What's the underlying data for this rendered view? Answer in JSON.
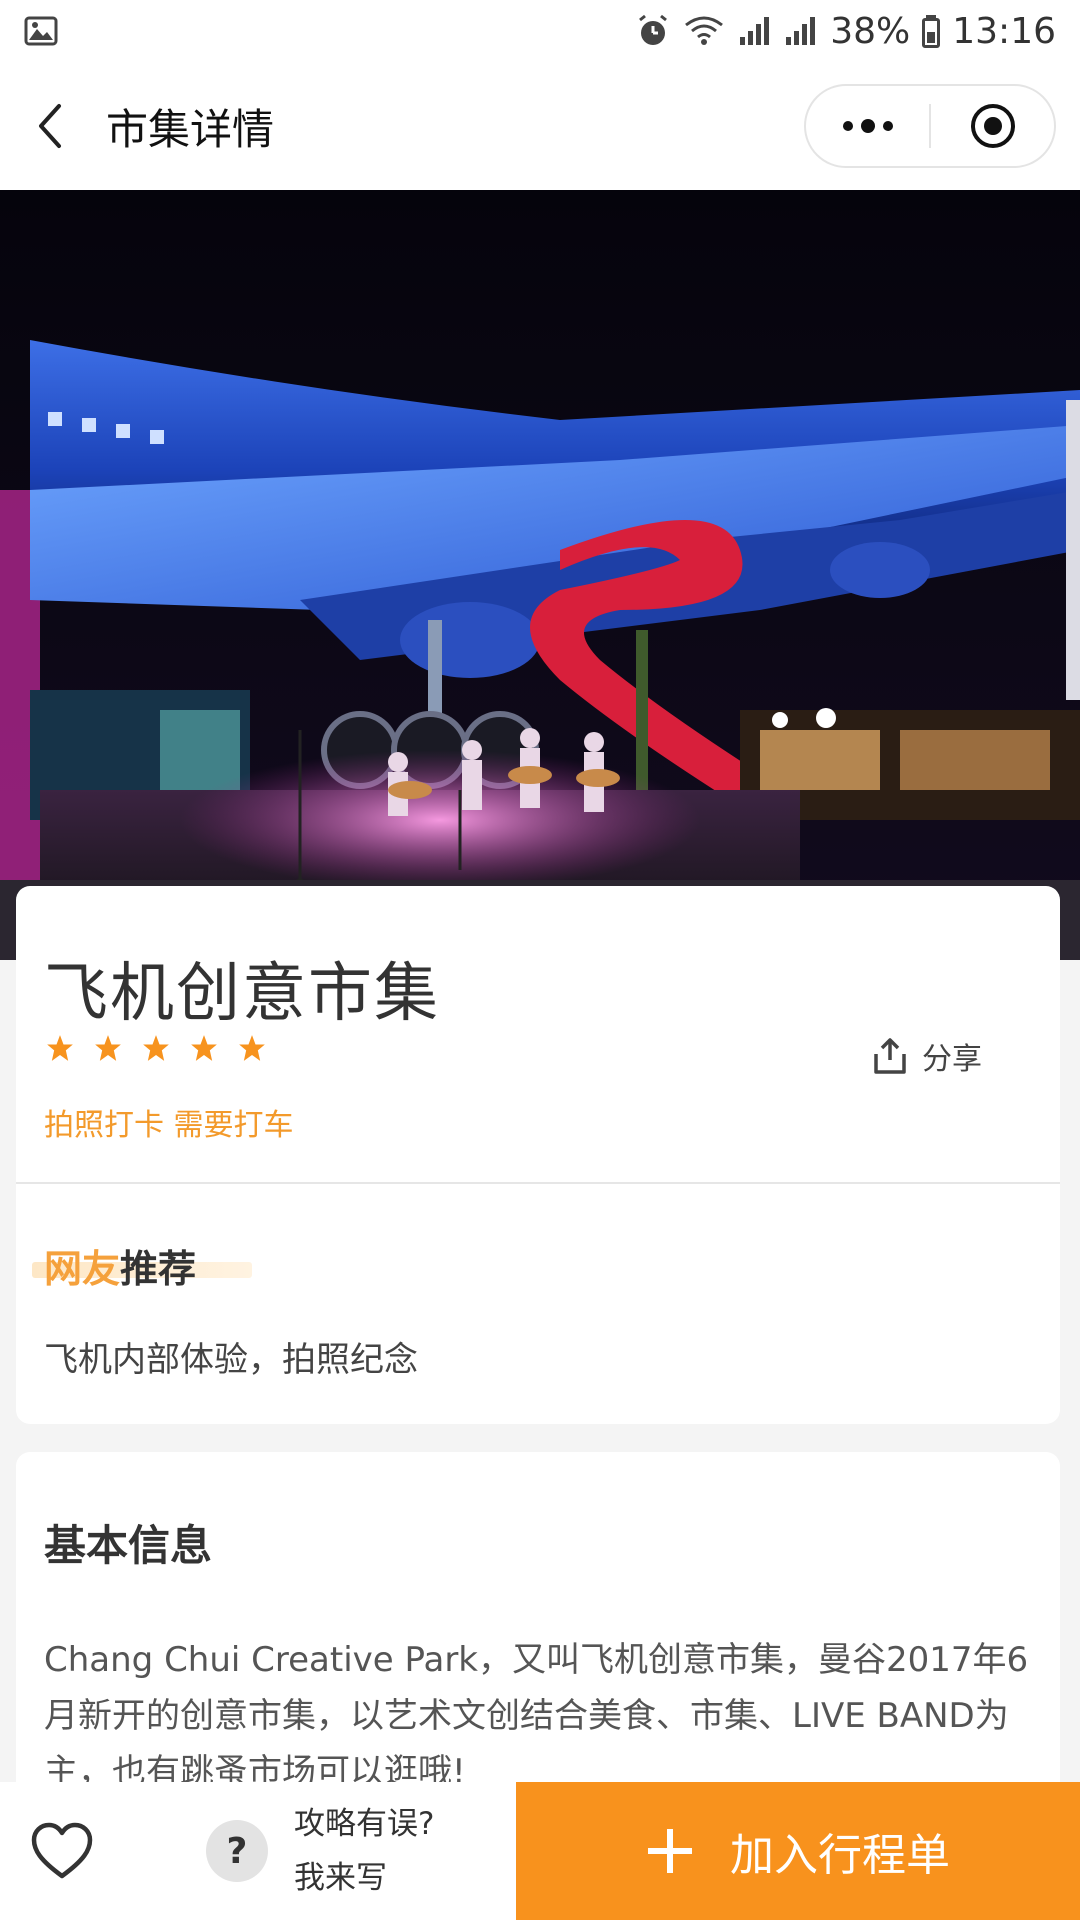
{
  "status_bar": {
    "battery": "38%",
    "time": "13:16",
    "icons": [
      "image-icon",
      "alarm-icon",
      "wifi-icon",
      "signal-icon",
      "signal-4g-icon",
      "battery-icon"
    ]
  },
  "nav": {
    "title": "市集详情",
    "back_icon": "chevron-left-icon",
    "more_icon": "more-dots-icon",
    "close_icon": "target-icon"
  },
  "place": {
    "name": "飞机创意市集",
    "rating": 5,
    "rating_max": 5,
    "share_label": "分享",
    "tags": "拍照打卡 需要打车"
  },
  "recommendation": {
    "title_highlight": "网友",
    "title_rest": "推荐",
    "text": "飞机内部体验，拍照纪念"
  },
  "basic_info": {
    "title": "基本信息",
    "text": "Chang Chui Creative Park，又叫飞机创意市集，曼谷2017年6月新开的创意市集，以艺术文创结合美食、市集、LIVE BAND为主，也有跳蚤市场可以逛哦!"
  },
  "bottom_bar": {
    "help_question": "攻略有误?",
    "help_action": "我来写",
    "add_label": "加入行程单",
    "help_icon_glyph": "?"
  },
  "colors": {
    "accent": "#f8921d",
    "star": "#f7931e",
    "tag": "#f39a2b"
  }
}
